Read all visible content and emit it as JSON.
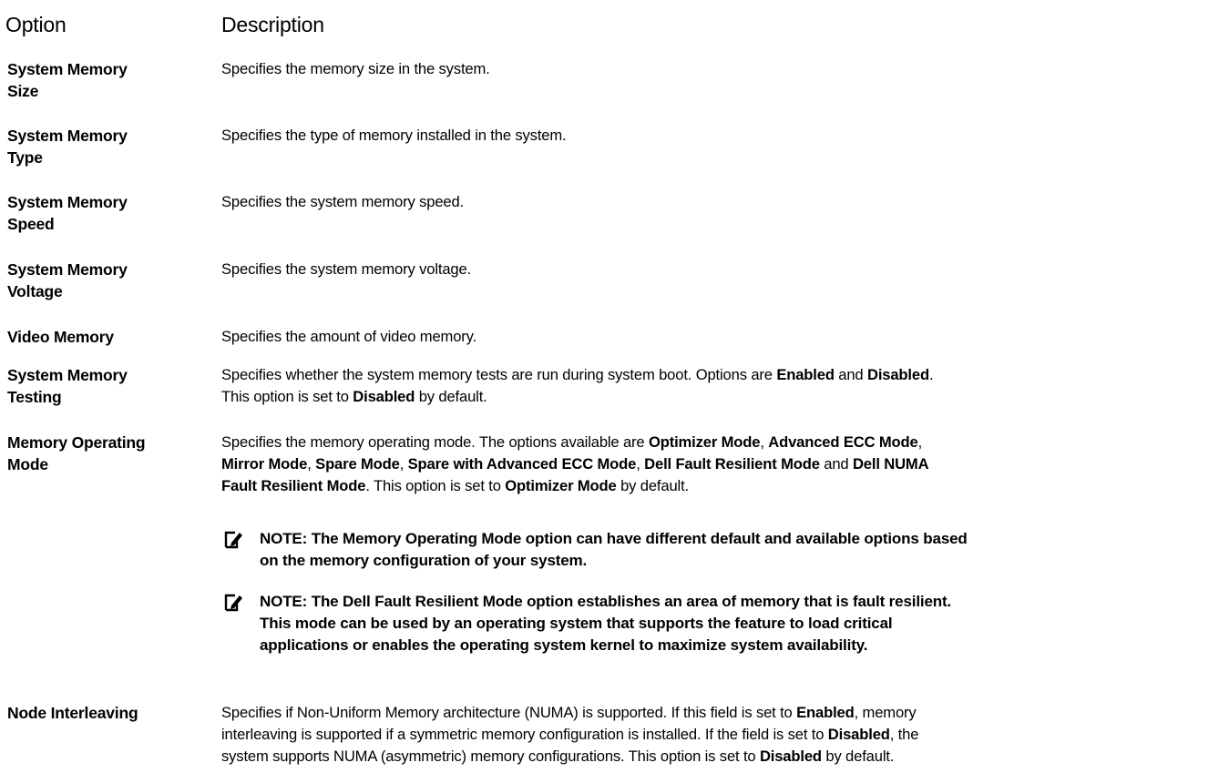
{
  "header": {
    "option": "Option",
    "description": "Description"
  },
  "rows": [
    {
      "option": [
        "System Memory",
        "Size"
      ],
      "description": [
        "Specifies the memory size in the system."
      ]
    },
    {
      "option": [
        "System Memory",
        "Type"
      ],
      "description": [
        "Specifies the type of memory installed in the system."
      ]
    },
    {
      "option": [
        "System Memory",
        "Speed"
      ],
      "description": [
        "Specifies the system memory speed."
      ]
    },
    {
      "option": [
        "System Memory",
        "Voltage"
      ],
      "description": [
        "Specifies the system memory voltage."
      ]
    },
    {
      "option": [
        "Video Memory"
      ],
      "description": [
        "Specifies the amount of video memory."
      ]
    },
    {
      "option": [
        "System Memory",
        "Testing"
      ],
      "description_parts": {
        "p1": "Specifies whether the system memory tests are run during system boot. Options are ",
        "enabled": "Enabled",
        "and": " and ",
        "disabled": "Disabled",
        "dot": ".",
        "p2": "This option is set to ",
        "disabled2": "Disabled",
        "p3": " by default."
      }
    },
    {
      "option": [
        "Memory Operating",
        "Mode"
      ],
      "description_parts": {
        "p1": "Specifies the memory operating mode. The options available are ",
        "optimizer": "Optimizer Mode",
        "c1": ", ",
        "advanced": "Advanced ECC Mode",
        "c2": ",",
        "mirror": "Mirror Mode",
        "c3": ", ",
        "spare": "Spare Mode",
        "c4": ", ",
        "spare_adv": "Spare with Advanced ECC Mode",
        "c5": ", ",
        "dell_fault": "Dell Fault Resilient Mode",
        "and": " and ",
        "dell_numa_1": "Dell NUMA",
        "dell_numa_2": "Fault Resilient Mode",
        "p2": ". This option is set to ",
        "optimizer2": "Optimizer Mode",
        "p3": " by default."
      },
      "notes": [
        {
          "lines": [
            "NOTE: The Memory Operating Mode option can have different default and available options based",
            "on the memory configuration of your system."
          ]
        },
        {
          "lines": [
            "NOTE: The Dell Fault Resilient Mode option establishes an area of memory that is fault resilient.",
            "This mode can be used by an operating system that supports the feature to load critical",
            "applications or enables the operating system kernel to maximize system availability."
          ]
        }
      ]
    },
    {
      "option": [
        "Node Interleaving"
      ],
      "description_parts": {
        "p1": "Specifies if Non-Uniform Memory architecture (NUMA) is supported. If this field is set to ",
        "enabled": "Enabled",
        "p2": ", memory",
        "p3": "interleaving is supported if a symmetric memory configuration is installed. If the field is set to ",
        "disabled": "Disabled",
        "p4": ", the",
        "p5": "system supports NUMA (asymmetric) memory configurations. This option is set to ",
        "disabled2": "Disabled",
        "p6": " by default."
      }
    }
  ],
  "icons": {
    "note": "pencil-note-icon"
  }
}
